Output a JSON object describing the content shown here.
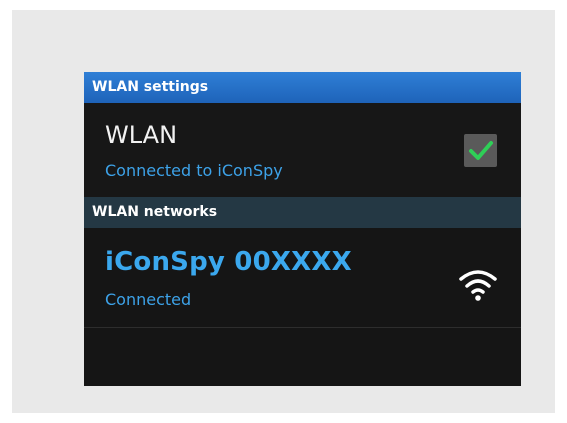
{
  "wlan_settings": {
    "header": "WLAN settings",
    "wlan_label": "WLAN",
    "wlan_status": "Connected to iConSpy",
    "checked": true
  },
  "wlan_networks": {
    "header": "WLAN networks",
    "network": {
      "name": "iConSpy 00XXXX",
      "status": "Connected",
      "icon": "wifi-icon"
    }
  },
  "colors": {
    "screen_background": "#151515",
    "settings_header": "#1e63b9",
    "networks_header": "#243844",
    "accent_blue": "#3da2e8",
    "checkmark_green": "#2fcf57"
  }
}
